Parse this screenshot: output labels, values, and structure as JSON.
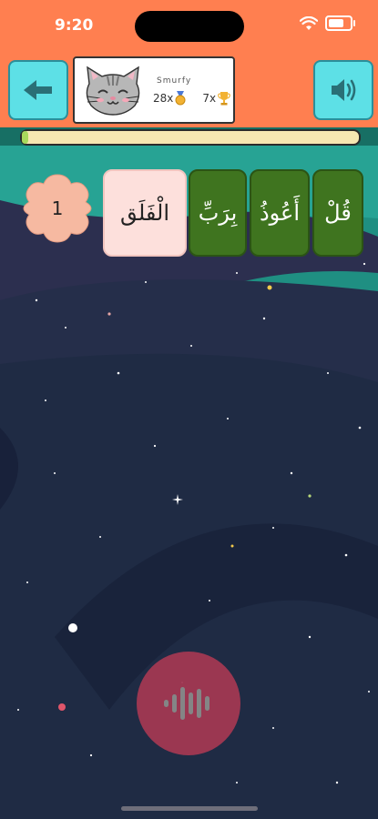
{
  "status_bar": {
    "time": "9:20"
  },
  "header": {
    "back_icon": "arrow-left-icon",
    "sound_icon": "speaker-icon",
    "profile": {
      "name": "Smurfy",
      "avatar": "cat-face",
      "medal_count": "28x",
      "trophy_count": "7x"
    }
  },
  "progress": {
    "fraction": 0.02
  },
  "verse": {
    "badge_number": "1",
    "words": [
      {
        "text": "قُلْ",
        "state": "completed"
      },
      {
        "text": "أَعُوذُ",
        "state": "completed"
      },
      {
        "text": "بِرَبِّ",
        "state": "completed"
      },
      {
        "text": "الْفَلَق",
        "state": "current"
      }
    ]
  },
  "mic": {
    "icon": "waveform-icon"
  },
  "colors": {
    "header": "#ff7f50",
    "button": "#5de0e6",
    "word_completed": "#3f741f",
    "word_current": "#fde0dc",
    "badge": "#f6b9a1",
    "mic": "#a23852"
  }
}
